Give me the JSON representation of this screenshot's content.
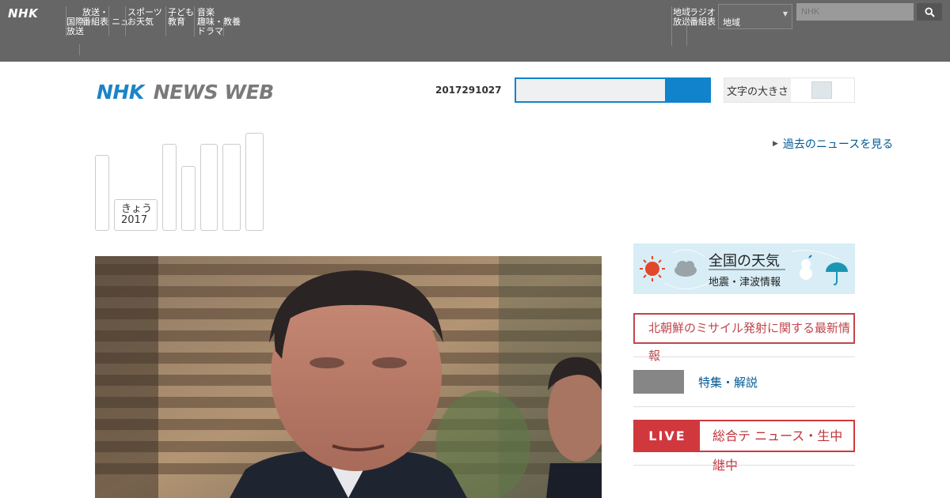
{
  "global_nav": {
    "logo": "NHK",
    "items": [
      "国際\n放送",
      "放送・\n番組表",
      "ニュ",
      "スポーツ\nお天気",
      "子ども\n教育",
      "音楽\n趣味・教養\nドラマ"
    ],
    "right_items": [
      "地域\n放送",
      "ラジオ\n番組表"
    ],
    "select_value": "地域",
    "search_placeholder": "NHK"
  },
  "news_header": {
    "logo_nhk": "NHK",
    "logo_news_web": "NEWS WEB",
    "date": "2017291027",
    "text_toggle_label": "文字の大きさ"
  },
  "calendar": {
    "today_label": "きょう",
    "today_year": "2017",
    "archive_link": "過去のニュースを見る"
  },
  "sidebar": {
    "weather_title": "全国の天気",
    "weather_subtitle": "地震・津波情報",
    "alert_text": "北朝鮮のミサイル発射に関する最新情報",
    "link_text": "特集・解説",
    "live_badge": "LIVE",
    "live_text": "総合テ ニュース・生中継中"
  },
  "colors": {
    "global_bar": "#666666",
    "brand_blue": "#1c84c6",
    "search_blue": "#1083cc",
    "alert_red": "#c0464b",
    "live_red": "#d0383e",
    "link_blue": "#005a94"
  }
}
